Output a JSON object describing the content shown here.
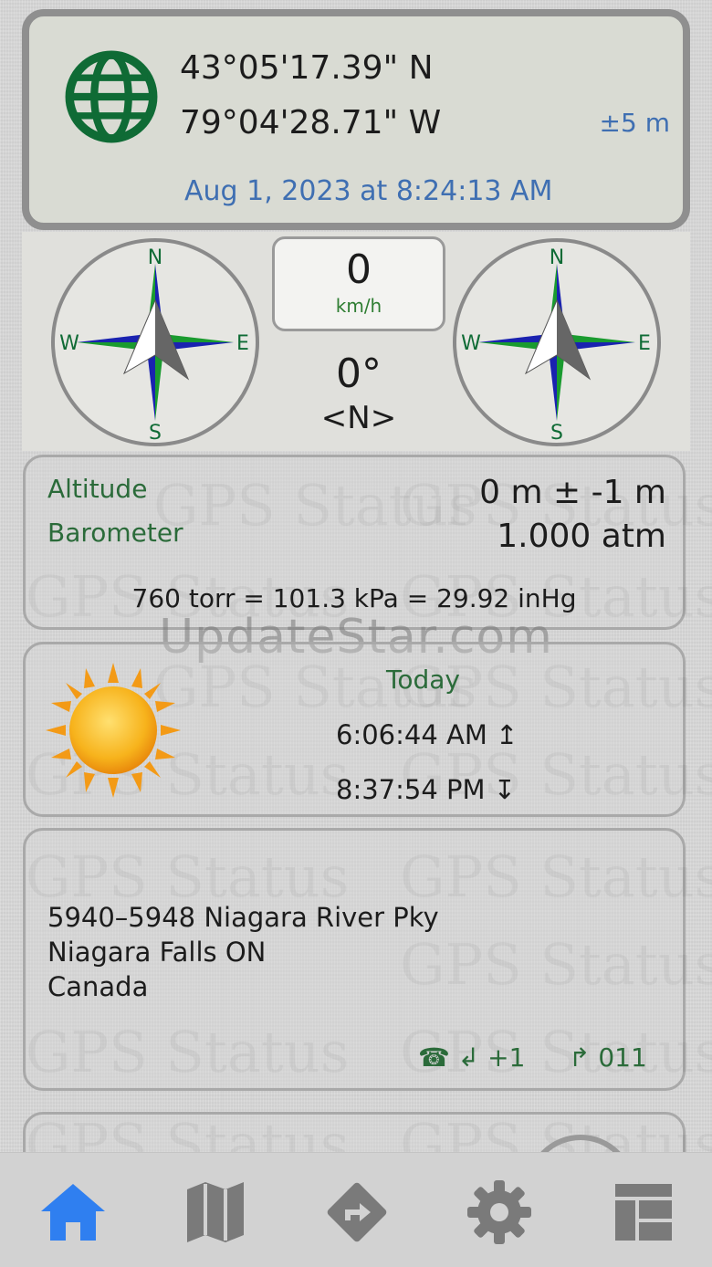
{
  "location": {
    "latitude": "43°05'17.39\" N",
    "longitude": "79°04'28.71\" W",
    "accuracy": "±5 m",
    "timestamp": "Aug 1, 2023 at 8:24:13 AM"
  },
  "compass": {
    "north": "N",
    "south": "S",
    "east": "E",
    "west": "W",
    "speed_value": "0",
    "speed_unit": "km/h",
    "heading": "0°",
    "heading_direction": "<N>"
  },
  "altitude": {
    "altitude_label": "Altitude",
    "altitude_value": "0 m ± -1 m",
    "barometer_label": "Barometer",
    "barometer_value": "1.000 atm",
    "conversion": "760 torr = 101.3 kPa = 29.92 inHg"
  },
  "watermark": {
    "site": "UpdateStar.com",
    "app": "GPS Status"
  },
  "sun": {
    "title": "Today",
    "sunrise": "6:06:44 AM ↥",
    "sunset": "8:37:54 PM ↧"
  },
  "address": {
    "line1": "5940–5948 Niagara River Pky",
    "line2": "Niagara Falls ON",
    "line3": "Canada",
    "phone_prefix": "☎ ↲ +1",
    "intl_prefix": "↱ 011"
  },
  "colors": {
    "accent_blue": "#3f6fb2",
    "label_green": "#2b6b3a",
    "tab_active": "#2f7ff0",
    "tab_inactive": "#7a7a7a"
  },
  "tabs": [
    {
      "icon": "home-icon",
      "active": true
    },
    {
      "icon": "map-icon",
      "active": false
    },
    {
      "icon": "directions-icon",
      "active": false
    },
    {
      "icon": "gear-icon",
      "active": false
    },
    {
      "icon": "dashboard-icon",
      "active": false
    }
  ]
}
